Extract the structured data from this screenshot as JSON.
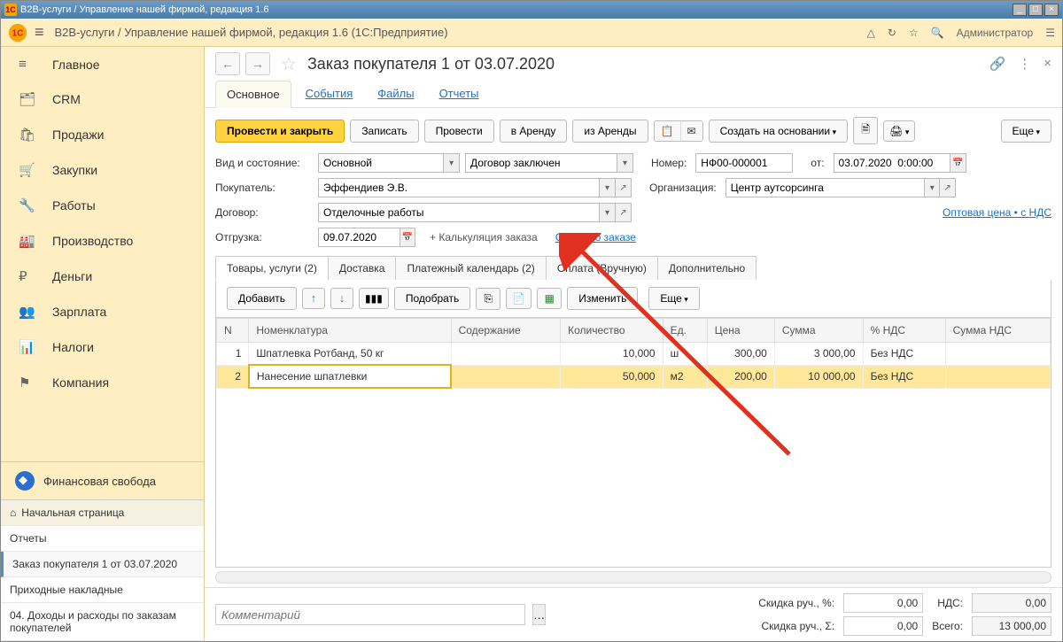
{
  "titlebar": {
    "text": "B2B-услуги / Управление нашей фирмой, редакция 1.6"
  },
  "topbar": {
    "breadcrumb": "B2B-услуги / Управление нашей фирмой, редакция 1.6  (1С:Предприятие)",
    "admin": "Администратор"
  },
  "sidebar": {
    "items": [
      {
        "icon": "≡",
        "label": "Главное"
      },
      {
        "icon": "🗂",
        "label": "CRM"
      },
      {
        "icon": "🛍",
        "label": "Продажи"
      },
      {
        "icon": "🛒",
        "label": "Закупки"
      },
      {
        "icon": "🔧",
        "label": "Работы"
      },
      {
        "icon": "🏭",
        "label": "Производство"
      },
      {
        "icon": "₽",
        "label": "Деньги"
      },
      {
        "icon": "👥",
        "label": "Зарплата"
      },
      {
        "icon": "📊",
        "label": "Налоги"
      },
      {
        "icon": "⚑",
        "label": "Компания"
      }
    ],
    "finfree": "Финансовая свобода",
    "bottom": {
      "home": "Начальная страница",
      "items": [
        "Отчеты",
        "Заказ покупателя 1 от 03.07.2020",
        "Приходные накладные",
        "04. Доходы и расходы по заказам покупателей"
      ]
    }
  },
  "doc": {
    "title": "Заказ покупателя 1 от 03.07.2020",
    "topTabs": [
      "Основное",
      "События",
      "Файлы",
      "Отчеты"
    ],
    "cmds": {
      "postClose": "Провести и закрыть",
      "write": "Записать",
      "post": "Провести",
      "toRent": "в Аренду",
      "fromRent": "из Аренды",
      "createBased": "Создать на основании",
      "more": "Еще"
    },
    "fields": {
      "typeStateLabel": "Вид и состояние:",
      "type": "Основной",
      "state": "Договор заключен",
      "numberLabel": "Номер:",
      "number": "НФ00-000001",
      "fromLabel": "от:",
      "date": "03.07.2020  0:00:00",
      "buyerLabel": "Покупатель:",
      "buyer": "Эффендиев Э.В.",
      "orgLabel": "Организация:",
      "org": "Центр аутсорсинга",
      "contractLabel": "Договор:",
      "contract": "Отделочные работы",
      "priceLink": "Оптовая цена • с НДС",
      "shipLabel": "Отгрузка:",
      "shipDate": "09.07.2020",
      "calcLink": "+ Калькуляция заказа",
      "summaryLink": "Сводно о заказе"
    },
    "subTabs": [
      "Товары, услуги (2)",
      "Доставка",
      "Платежный календарь (2)",
      "Оплата (Вручную)",
      "Дополнительно"
    ],
    "gridCmds": {
      "add": "Добавить",
      "pick": "Подобрать",
      "edit": "Изменить",
      "more": "Еще"
    },
    "gridCols": [
      "N",
      "Номенклатура",
      "Содержание",
      "Количество",
      "Ед.",
      "Цена",
      "Сумма",
      "% НДС",
      "Сумма НДС"
    ],
    "gridRows": [
      {
        "n": "1",
        "nom": "Шпатлевка Ротбанд, 50 кг",
        "cont": "",
        "qty": "10,000",
        "unit": "ш",
        "price": "300,00",
        "sum": "3 000,00",
        "vat": "Без НДС",
        "vsum": ""
      },
      {
        "n": "2",
        "nom": "Нанесение шпатлевки",
        "cont": "",
        "qty": "50,000",
        "unit": "м2",
        "price": "200,00",
        "sum": "10 000,00",
        "vat": "Без НДС",
        "vsum": ""
      }
    ],
    "footer": {
      "commentPlaceholder": "Комментарий",
      "discPctLabel": "Скидка руч., %:",
      "discPct": "0,00",
      "discSumLabel": "Скидка руч., Σ:",
      "discSum": "0,00",
      "vatLabel": "НДС:",
      "vat": "0,00",
      "totalLabel": "Всего:",
      "total": "13 000,00"
    }
  }
}
